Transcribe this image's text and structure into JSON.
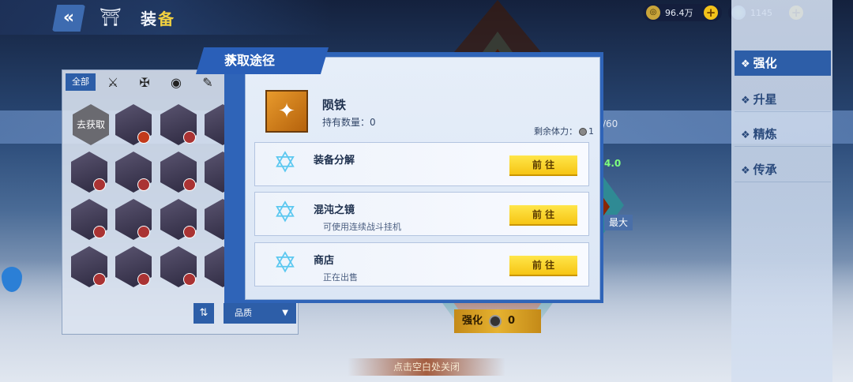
{
  "header": {
    "back_icon": "double-chevron-left",
    "title_main": "装",
    "title_accent": "备"
  },
  "currency": {
    "coins": "96.4万",
    "gems": "1145"
  },
  "right_menu": {
    "items": [
      {
        "label": "强化",
        "active": true
      },
      {
        "label": "升星",
        "active": false
      },
      {
        "label": "精炼",
        "active": false
      },
      {
        "label": "传承",
        "active": false
      }
    ]
  },
  "left_panel": {
    "filter_all": "全部",
    "go_get": "去获取",
    "sort_icon": "sort-arrows",
    "quality": "品质"
  },
  "background_readouts": {
    "stamina_partial": "/60",
    "value_partial": "4.0",
    "max": "最大",
    "enhance_label": "强化",
    "enhance_cost": "0"
  },
  "dialog": {
    "title": "获取途径",
    "item_name": "陨铁",
    "item_count": "持有数量：0",
    "stamina_label": "剩余体力：",
    "stamina_value": "1",
    "sources": [
      {
        "name": "装备分解",
        "desc": "",
        "button": "前 往"
      },
      {
        "name": "混沌之镜",
        "desc": "可使用连续战斗挂机",
        "button": "前 往"
      },
      {
        "name": "商店",
        "desc": "正在出售",
        "button": "前 往"
      }
    ]
  },
  "close_hint": "点击空白处关闭",
  "colors": {
    "accent": "#2d5ea8",
    "button_yellow": "#f6c514"
  }
}
